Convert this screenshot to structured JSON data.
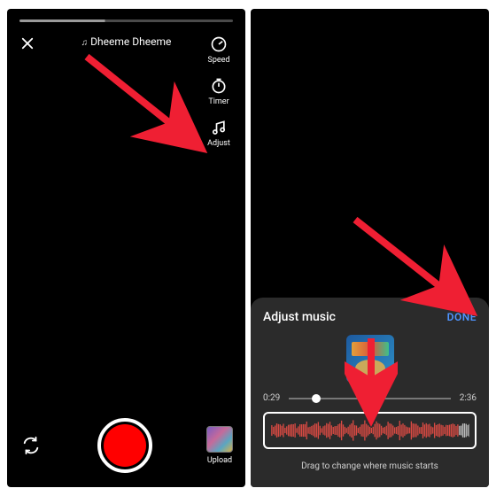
{
  "left": {
    "song_title": "Dheeme Dheeme",
    "tools": {
      "speed": "Speed",
      "timer": "Timer",
      "adjust": "Adjust"
    },
    "upload_label": "Upload"
  },
  "right": {
    "sheet_title": "Adjust music",
    "done_label": "DONE",
    "time_start": "0:29",
    "time_end": "2:36",
    "hint": "Drag to change where music starts"
  }
}
